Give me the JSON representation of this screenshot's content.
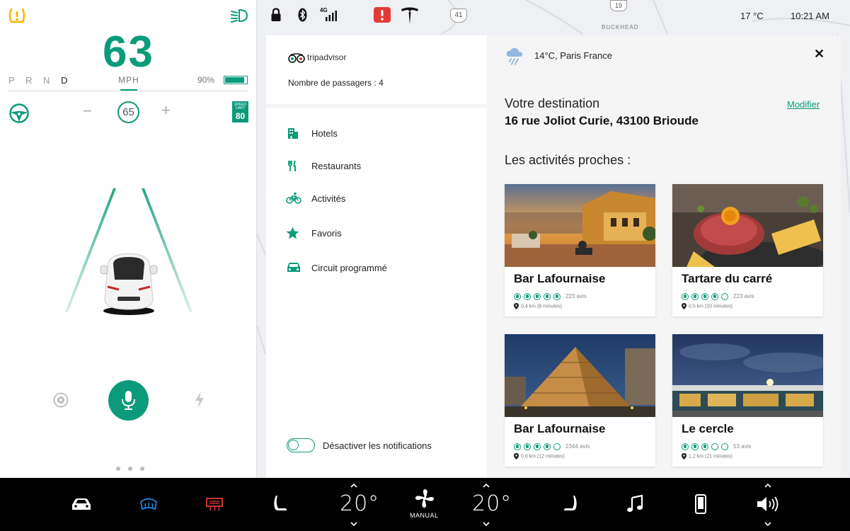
{
  "left_panel": {
    "speed": "63",
    "gears": {
      "inactive": "P R N ",
      "active": "D"
    },
    "speed_unit": "MPH",
    "battery_percent": "90%",
    "battery_level": 0.9,
    "set_speed": "65",
    "speed_limit": {
      "label": "SPEED LIMIT",
      "value": "80"
    },
    "minus": "−",
    "plus": "+"
  },
  "top_bar": {
    "network": "4G",
    "outside_temp": "17 °C",
    "time": "10:21 AM",
    "map_labels": {
      "route_41": "41",
      "route_19": "19",
      "area": "BUCKHEAD"
    }
  },
  "tripadvisor": {
    "logo_text": "tripadvisor",
    "passengers": "Nombre de passagers : 4",
    "menu": [
      {
        "label": "Hotels",
        "icon": "hotel-icon"
      },
      {
        "label": "Restaurants",
        "icon": "restaurant-icon"
      },
      {
        "label": "Activités",
        "icon": "bicycle-icon"
      },
      {
        "label": "Favoris",
        "icon": "star-icon"
      },
      {
        "label": "Circuit programmé",
        "icon": "car-icon"
      }
    ],
    "notifications_toggle": "Désactiver les notifications"
  },
  "destination": {
    "weather": "14°C, Paris France",
    "label": "Votre destination",
    "modify": "Modifier",
    "address": "16 rue Joliot Curie, 43100 Brioude",
    "nearby_title": "Les activités proches :",
    "cards": [
      {
        "name": "Bar Lafournaise",
        "rating": 5,
        "reviews": "223 avis",
        "distance": "0,4 km (8 minutes)"
      },
      {
        "name": "Tartare du carré",
        "rating": 4,
        "reviews": "223 avis",
        "distance": "0,5 km (10 minutes)"
      },
      {
        "name": "Bar Lafournaise",
        "rating": 4,
        "reviews": "2344 avis",
        "distance": "0,8 km (12 minutes)"
      },
      {
        "name": "Le cercle",
        "rating": 3,
        "reviews": "53 avis",
        "distance": "1,2 km (21 minutes)"
      }
    ]
  },
  "climate": {
    "driver_temp": "20°",
    "passenger_temp": "20°",
    "fan_mode": "MANUAL"
  },
  "colors": {
    "accent": "#0c9b7a",
    "alert": "#e53935",
    "warning": "#f5b800",
    "rear_defrost": "#e53935",
    "front_defrost": "#1e88e5"
  }
}
